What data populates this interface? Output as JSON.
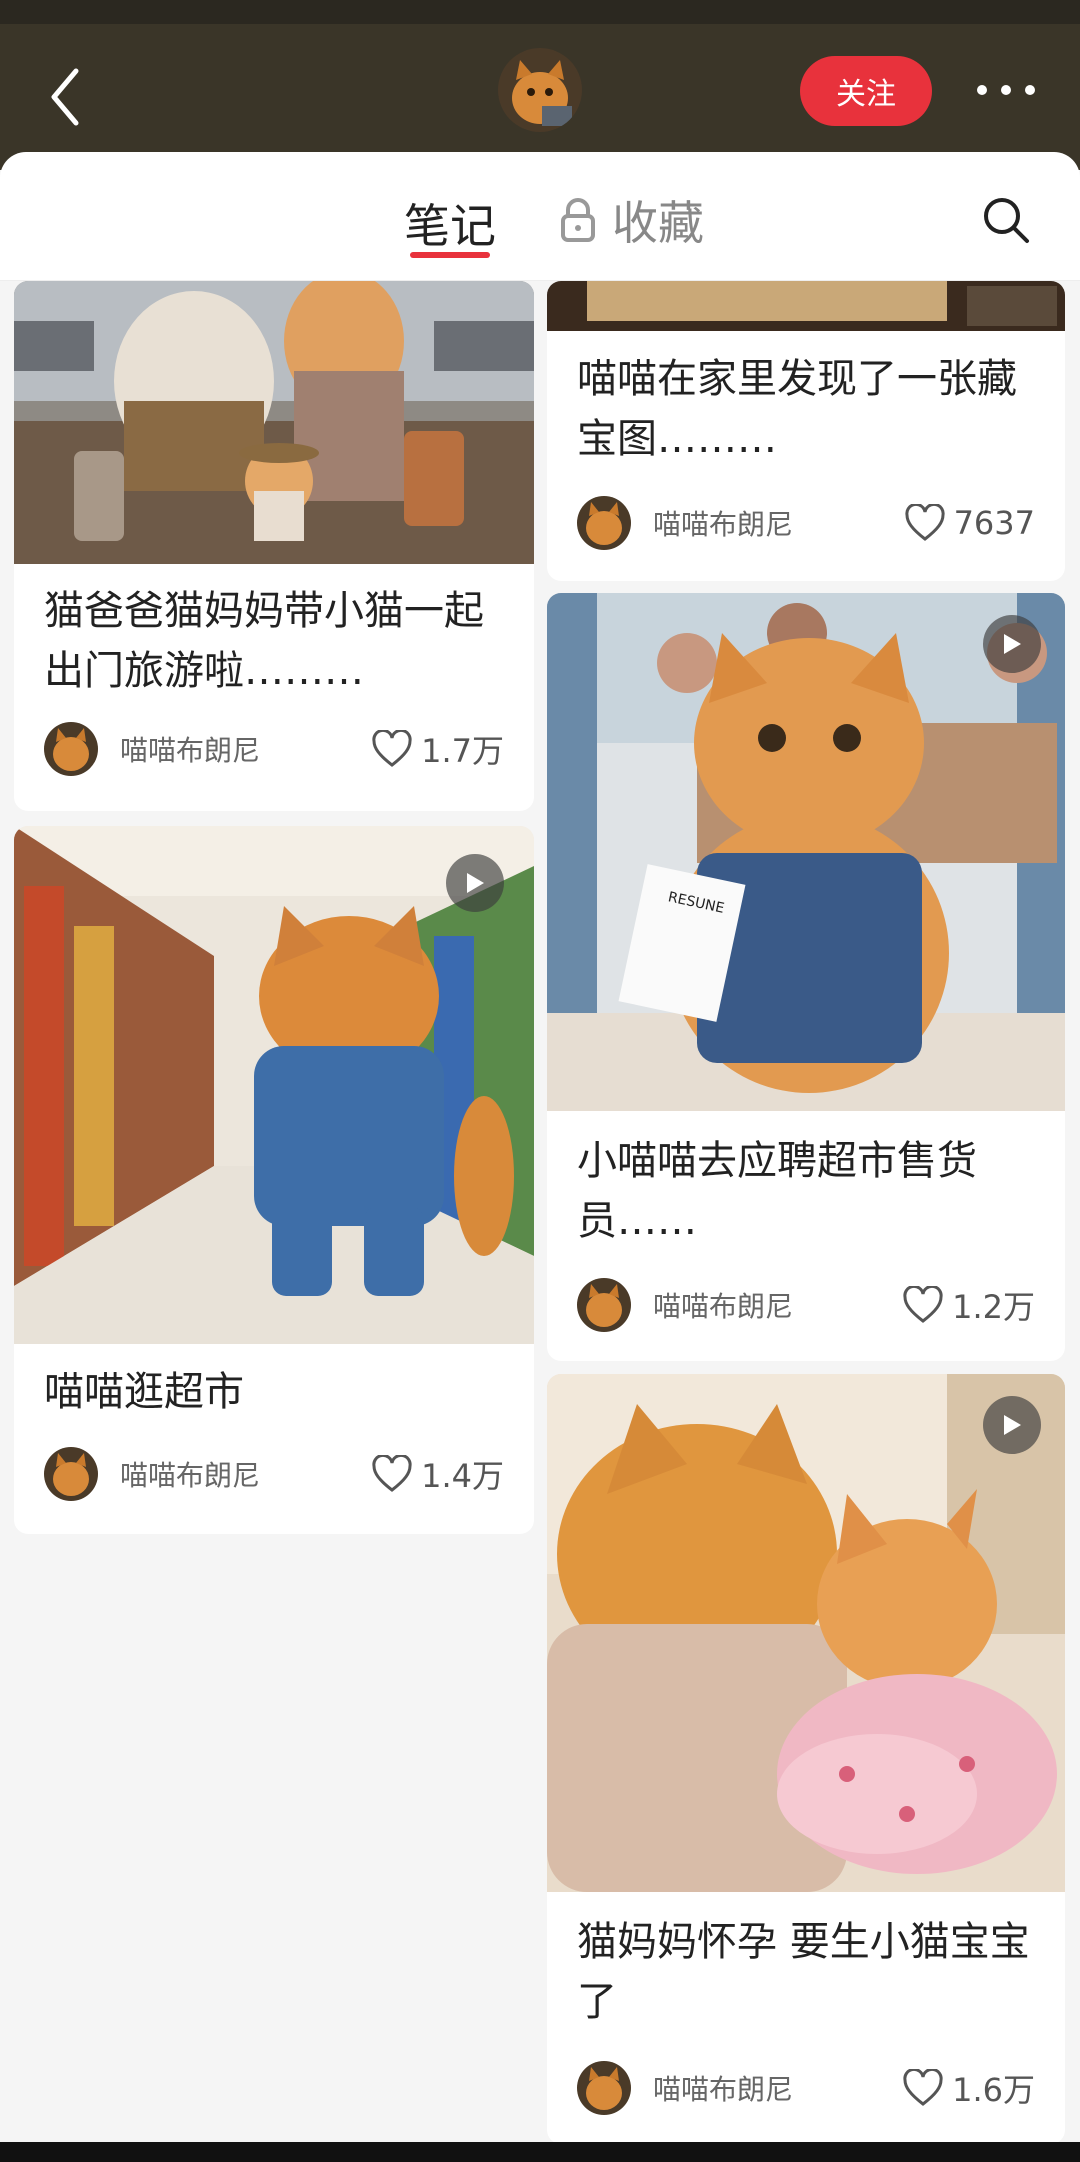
{
  "header": {
    "follow_label": "关注"
  },
  "tabs": {
    "notes_label": "笔记",
    "collect_label": "收藏"
  },
  "author_name": "喵喵布朗尼",
  "icons": {
    "back": "chevron-left-icon",
    "more": "more-dots-icon",
    "search": "search-icon",
    "lock": "lock-icon",
    "like": "heart-icon",
    "play": "play-icon"
  },
  "colors": {
    "accent": "#e8323c",
    "header_bg": "#3a3528"
  },
  "cards": [
    {
      "id": "c1",
      "title": "猫爸爸猫妈妈带小猫一起出门旅游啦………",
      "author": "喵喵布朗尼",
      "likes": "1.7万",
      "video": false,
      "image_subject": "cat family with suitcases at airport"
    },
    {
      "id": "c2",
      "title": "喵喵在家里发现了一张藏宝图………",
      "author": "喵喵布朗尼",
      "likes": "7637",
      "video": false,
      "image_subject": "treasure map on table"
    },
    {
      "id": "c3",
      "title": "小喵喵去应聘超市售货员……",
      "author": "喵喵布朗尼",
      "likes": "1.2万",
      "video": true,
      "image_subject": "cat in overalls holding RESUNE paper in supermarket",
      "image_text": "RESUNE"
    },
    {
      "id": "c4",
      "title": "喵喵逛超市",
      "author": "喵喵布朗尼",
      "likes": "1.4万",
      "video": true,
      "image_subject": "cat in denim shirt in supermarket aisle"
    },
    {
      "id": "c5",
      "title": "猫妈妈怀孕 要生小猫宝宝了",
      "author": "喵喵布朗尼",
      "likes": "1.6万",
      "video": true,
      "image_subject": "cat mother hugging pregnant cat in pink dress"
    }
  ]
}
